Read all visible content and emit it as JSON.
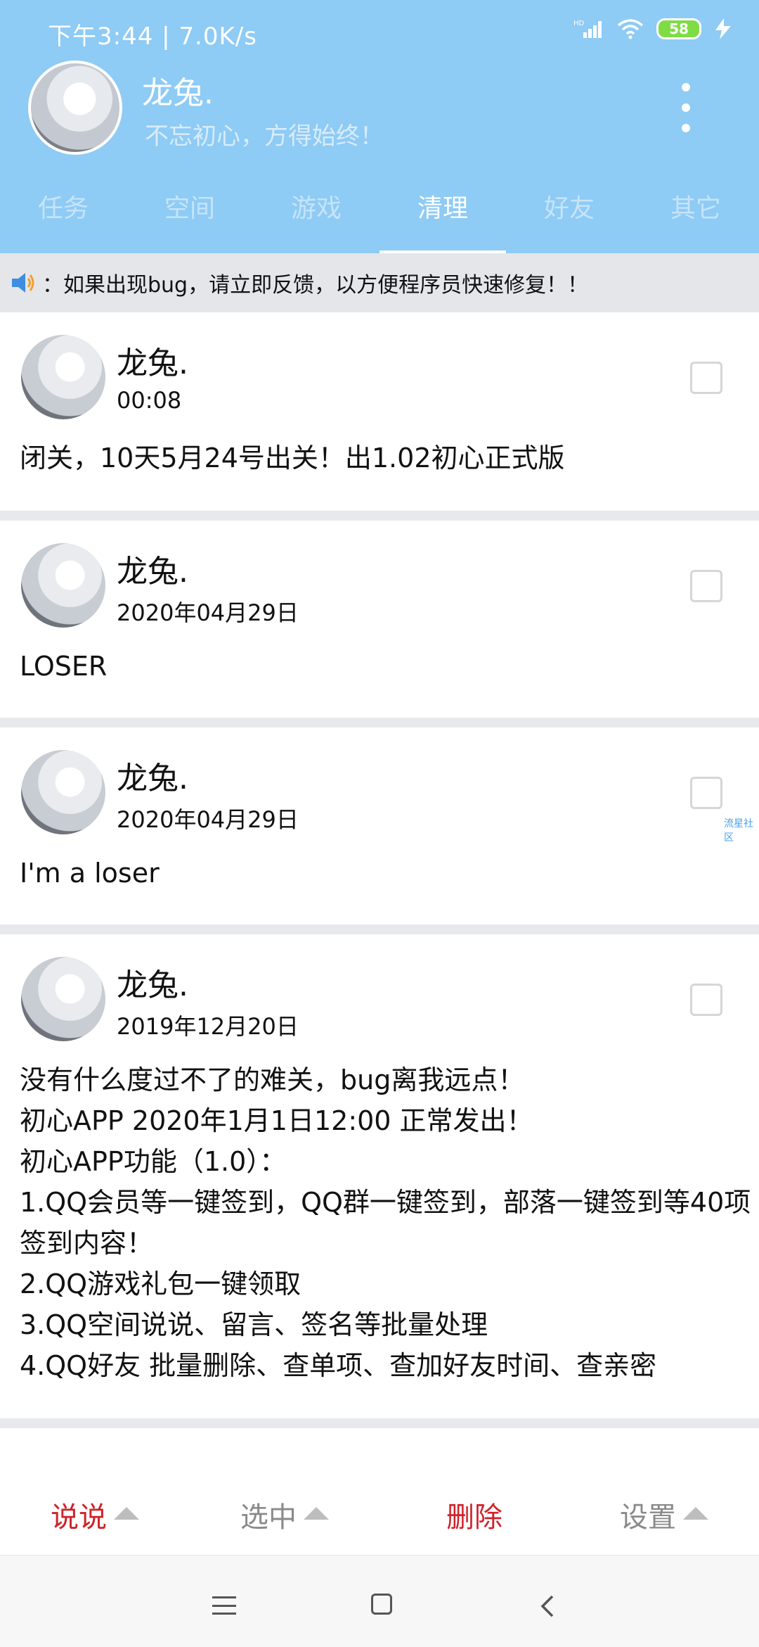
{
  "status_bar": {
    "left": "下午3:44 | 7.0K/s",
    "battery": "58"
  },
  "profile": {
    "name": "龙兔.",
    "motto": "不忘初心，方得始终！"
  },
  "tabs": [
    {
      "label": "任务"
    },
    {
      "label": "空间"
    },
    {
      "label": "游戏"
    },
    {
      "label": "清理"
    },
    {
      "label": "好友"
    },
    {
      "label": "其它"
    }
  ],
  "active_tab": "清理",
  "notice": {
    "text": "：如果出现bug，请立即反馈，以方便程序员快速修复！！"
  },
  "posts": [
    {
      "name": "龙兔.",
      "time": "00:08",
      "content": "闭关，10天5月24号出关！出1.02初心正式版"
    },
    {
      "name": "龙兔.",
      "time": "2020年04月29日",
      "content": "LOSER"
    },
    {
      "name": "龙兔.",
      "time": "2020年04月29日",
      "content": "I'm a loser"
    },
    {
      "name": "龙兔.",
      "time": "2019年12月20日",
      "content": "没有什么度过不了的难关，bug离我远点！\n初心APP 2020年1月1日12:00 正常发出！\n初心APP功能（1.0）：\n1.QQ会员等一键签到，QQ群一键签到，部落一键签到等40项签到内容！\n2.QQ游戏礼包一键领取\n3.QQ空间说说、留言、签名等批量处理\n4.QQ好友 批量删除、查单项、查加好友时间、查亲密"
    }
  ],
  "watermark": "流星社区",
  "bottom_bar": {
    "shuoshuo": "说说",
    "select": "选中",
    "delete": "删除",
    "settings": "设置"
  },
  "colors": {
    "header": "#8ecbf5",
    "red_action": "#d0222a",
    "gray_action": "#8a8a8a"
  }
}
